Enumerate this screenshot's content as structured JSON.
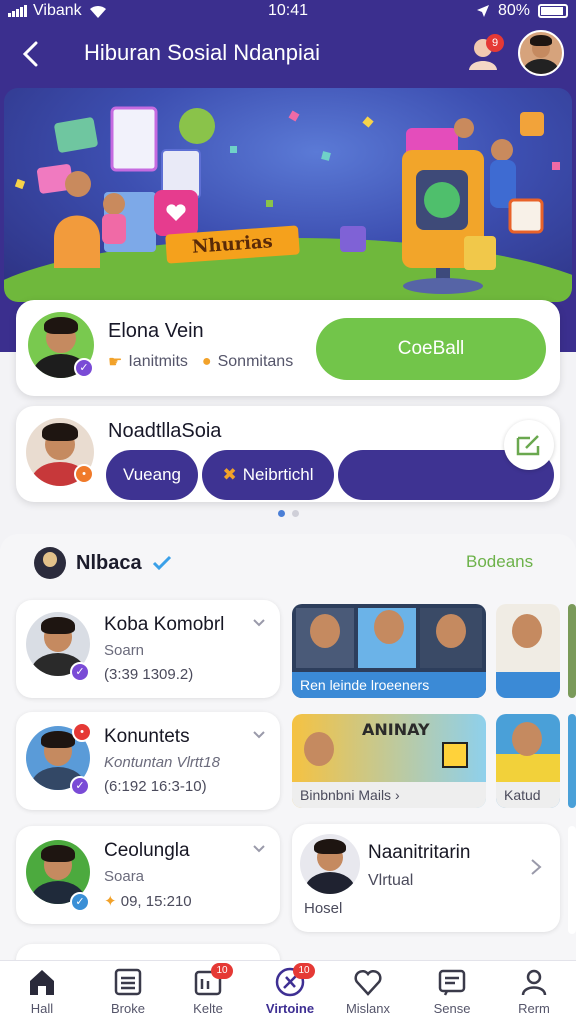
{
  "status_bar": {
    "carrier": "Vibank",
    "time": "10:41",
    "battery": "80%"
  },
  "header": {
    "title": "Hiburan Sosial Ndanpiai",
    "notification_count": "9"
  },
  "banner": {
    "label": "Nhurias"
  },
  "profile_card_1": {
    "name": "Elona Vein",
    "meta_1": "Ianitmits",
    "meta_2": "Sonmitans",
    "action_label": "CoeBall"
  },
  "profile_card_2": {
    "name": "NoadtllaSoia",
    "pill_1": "Vueang",
    "pill_2": "Neibrtichl"
  },
  "feed": {
    "title": "Nlbaca",
    "link": "Bodeans",
    "groups": [
      {
        "name": "Koba Komobrl",
        "sub": "Soarn",
        "time": "(3:39 1309.2)"
      },
      {
        "name": "Konuntets",
        "sub": "Kontuntan Vlrtt18",
        "time": "(6:192 16:3-10)"
      },
      {
        "name": "Ceolungla",
        "sub": "Soara",
        "time": "09, 15:210"
      }
    ],
    "tiles": [
      {
        "caption": "Ren leinde lroeeners"
      },
      {
        "caption": "Binbnbni Mails"
      },
      {
        "caption": "Katud"
      }
    ],
    "wide_card": {
      "name": "Naanitritarin",
      "sub": "Vlrtual",
      "foot": "Hosel"
    },
    "banner_tile_text": "ANINAY"
  },
  "bottom_nav": [
    {
      "label": "Hall",
      "icon": "home-icon"
    },
    {
      "label": "Broke",
      "icon": "list-icon"
    },
    {
      "label": "Kelte",
      "icon": "chat-icon",
      "badge": "10"
    },
    {
      "label": "Virtoine",
      "icon": "explore-icon",
      "badge": "10",
      "active": true
    },
    {
      "label": "Mislanx",
      "icon": "heart-icon"
    },
    {
      "label": "Sense",
      "icon": "message-icon"
    },
    {
      "label": "Rerm",
      "icon": "profile-icon"
    }
  ],
  "colors": {
    "brand": "#3b2f8e",
    "accent_green": "#72c54a",
    "badge_red": "#e53935"
  }
}
